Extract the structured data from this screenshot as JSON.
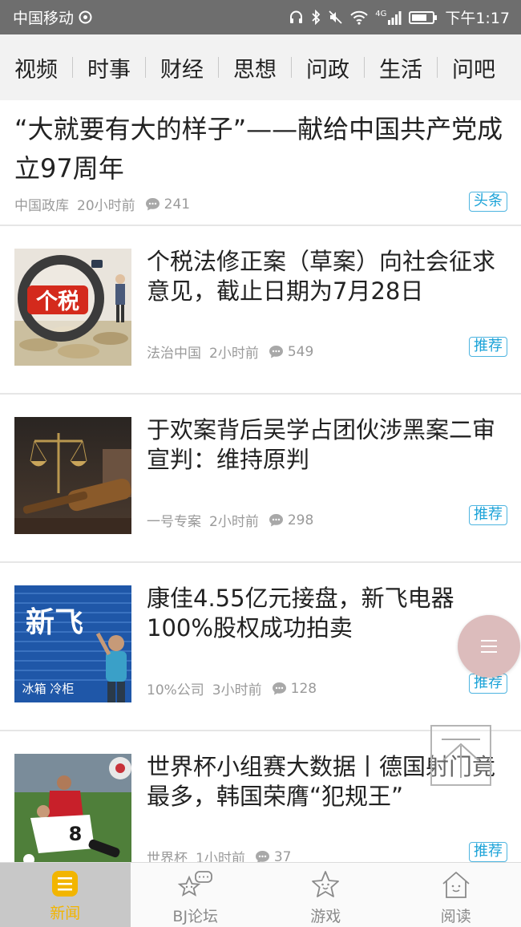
{
  "status_bar": {
    "carrier": "中国移动",
    "network": "4G",
    "time": "下午1:17"
  },
  "categories": [
    "视频",
    "时事",
    "财经",
    "思想",
    "问政",
    "生活",
    "问吧"
  ],
  "headline": {
    "title": "“大就要有大的样子”——献给中国共产党成立97周年",
    "source": "中国政库",
    "time": "20小时前",
    "comments": "241",
    "badge": "头条"
  },
  "articles": [
    {
      "title": "个税法修正案（草案）向社会征求意见，截止日期为7月28日",
      "source": "法治中国",
      "time": "2小时前",
      "comments": "549",
      "badge": "推荐",
      "thumb_text": "个税"
    },
    {
      "title": "于欢案背后吴学占团伙涉黑案二审宣判：维持原判",
      "source": "一号专案",
      "time": "2小时前",
      "comments": "298",
      "badge": "推荐"
    },
    {
      "title": "康佳4.55亿元接盘，新飞电器100%股权成功拍卖",
      "source": "10%公司",
      "time": "3小时前",
      "comments": "128",
      "badge": "推荐",
      "thumb_text": "新飞",
      "thumb_subtext": "冰箱 冷柜"
    },
    {
      "title": "世界杯小组赛大数据丨德国射门竟最多，韩国荣膺“犯规王”",
      "source": "世界杯",
      "time": "1小时前",
      "comments": "37",
      "badge": "推荐",
      "thumb_text": "8"
    }
  ],
  "bottom_nav": [
    {
      "label": "新闻",
      "icon": "news-icon",
      "active": true
    },
    {
      "label": "BJ论坛",
      "icon": "forum-star-chat-icon",
      "active": false
    },
    {
      "label": "游戏",
      "icon": "game-star-icon",
      "active": false
    },
    {
      "label": "阅读",
      "icon": "reading-house-icon",
      "active": false
    }
  ],
  "colors": {
    "badge": "#1ca3d8",
    "active_tab": "#f2b500",
    "fab": "#dcbcbc"
  }
}
